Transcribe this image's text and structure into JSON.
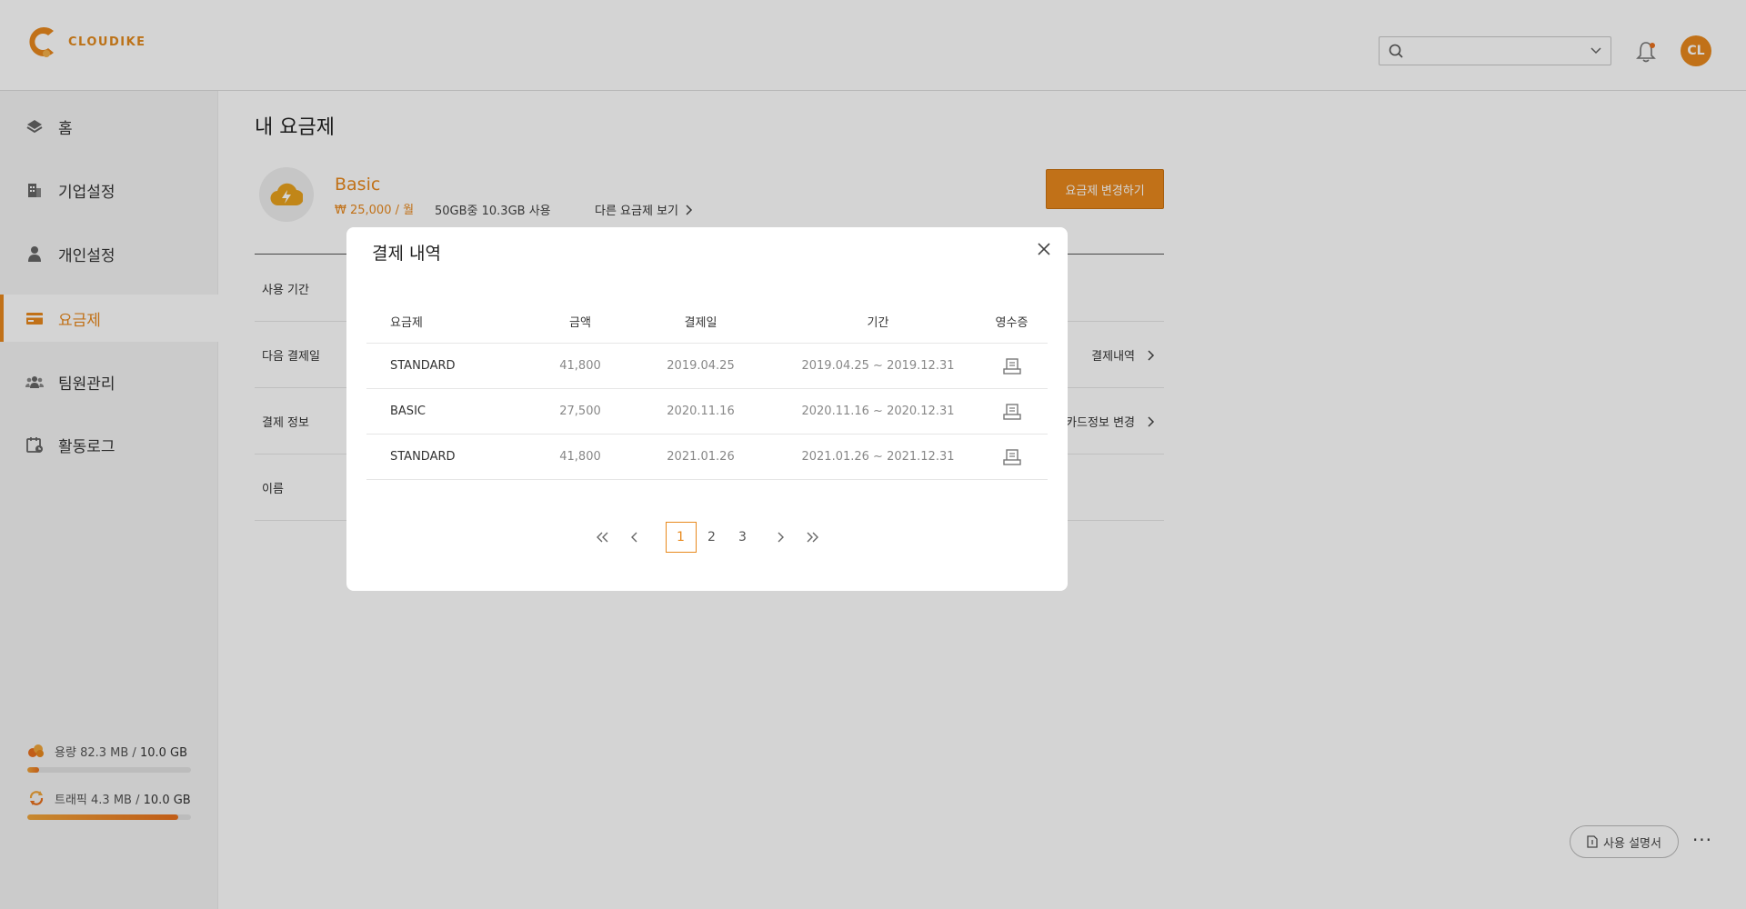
{
  "header": {
    "logo_text": "CLOUDIKE",
    "search_placeholder": "",
    "avatar_initials": "CL"
  },
  "sidebar": {
    "items": [
      {
        "label": "홈",
        "icon": "layers-icon"
      },
      {
        "label": "기업설정",
        "icon": "building-icon"
      },
      {
        "label": "개인설정",
        "icon": "person-icon"
      },
      {
        "label": "요금제",
        "icon": "card-icon",
        "active": true
      },
      {
        "label": "팀원관리",
        "icon": "team-icon"
      },
      {
        "label": "활동로그",
        "icon": "calendar-log-icon"
      }
    ],
    "storage": {
      "label": "용량",
      "used": "82.3 MB",
      "total": "10.0 GB",
      "progress": 0.07
    },
    "traffic": {
      "label": "트래픽",
      "used": "4.3 MB",
      "total": "10.0 GB",
      "progress": 0.92
    }
  },
  "main": {
    "title": "내 요금제",
    "plan": {
      "name": "Basic",
      "price": "₩ 25,000 / 월",
      "usage": "50GB중 10.3GB 사용",
      "other_link": "다른 요금제 보기"
    },
    "change_button": "요금제 변경하기",
    "rows": [
      {
        "label": "사용 기간",
        "link": ""
      },
      {
        "label": "다음 결제일",
        "link": "결제내역"
      },
      {
        "label": "결제 정보",
        "link": "카드정보 변경"
      },
      {
        "label": "이름",
        "link": ""
      }
    ],
    "help_button": "사용 설명서",
    "more_label": "···"
  },
  "modal": {
    "title": "결제 내역",
    "columns": [
      "요금제",
      "금액",
      "결제일",
      "기간",
      "영수증"
    ],
    "rows": [
      {
        "plan": "STANDARD",
        "amount": "41,800",
        "date": "2019.04.25",
        "period": "2019.04.25 ~ 2019.12.31"
      },
      {
        "plan": "BASIC",
        "amount": "27,500",
        "date": "2020.11.16",
        "period": "2020.11.16 ~ 2020.12.31"
      },
      {
        "plan": "STANDARD",
        "amount": "41,800",
        "date": "2021.01.26",
        "period": "2021.01.26 ~ 2021.12.31"
      }
    ],
    "pages": [
      "1",
      "2",
      "3"
    ],
    "current_page": "1"
  },
  "colors": {
    "accent": "#e8891d",
    "overlay": "rgba(0,0,0,0.17)"
  }
}
